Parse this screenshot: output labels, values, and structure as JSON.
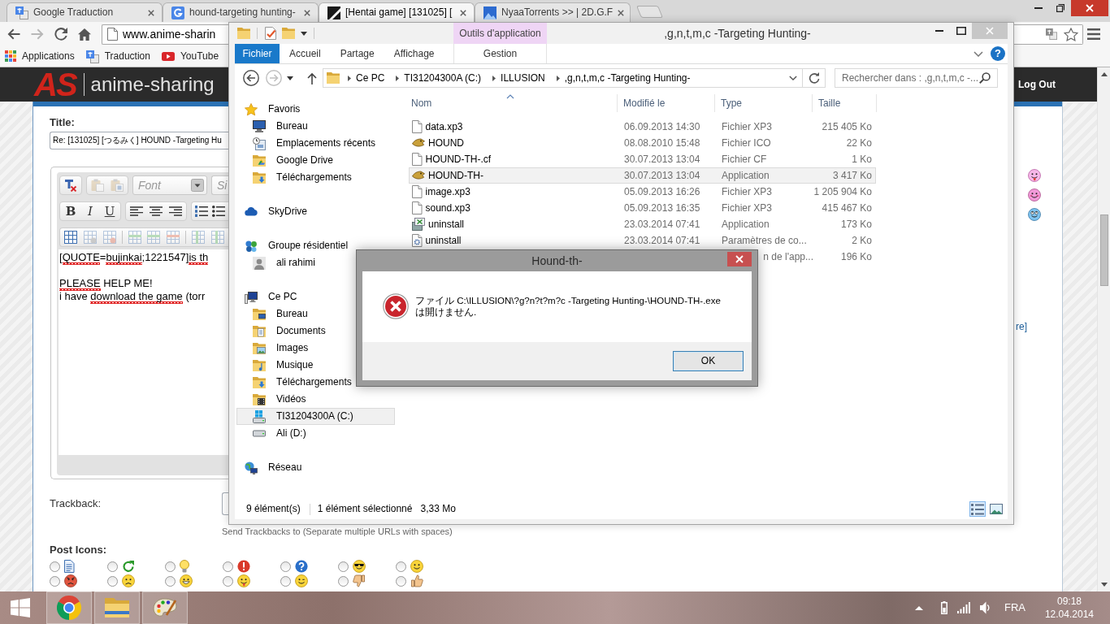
{
  "browser": {
    "tabs": [
      {
        "title": "Google Traduction",
        "kind": "translate",
        "selected": false
      },
      {
        "title": "hound-targeting hunting-",
        "kind": "search",
        "selected": false
      },
      {
        "title": "[Hentai game] [131025] [",
        "kind": "site",
        "selected": true
      },
      {
        "title": "NyaaTorrents >> | 2D.G.F",
        "kind": "torrents",
        "selected": false
      }
    ],
    "address": "www.anime-sharin",
    "bookmarks": [
      {
        "label": "Applications",
        "kind": "apps"
      },
      {
        "label": "Traduction",
        "kind": "translate"
      },
      {
        "label": "YouTube",
        "kind": "video"
      }
    ],
    "page": {
      "logo_mark": "AS",
      "site_name": "anime-sharing",
      "logout": "Log Out",
      "title_label": "Title:",
      "title_value": "Re: [131025] [つるみく] HOUND -Targeting Hu",
      "editor": {
        "toolbar": [
          {
            "kind": "boxed",
            "groups": [
              [
                {
                  "kind": "clear-format",
                  "disabled": false
                }
              ],
              [
                {
                  "kind": "paste",
                  "disabled": true
                },
                {
                  "kind": "paste-word",
                  "disabled": true
                }
              ],
              [
                {
                  "kind": "select",
                  "placeholder": "Font"
                }
              ],
              [
                {
                  "kind": "select",
                  "placeholder": "Si"
                }
              ]
            ]
          },
          {
            "kind": "boxed",
            "groups": [
              [
                {
                  "kind": "bold",
                  "label": "B"
                },
                {
                  "kind": "italic",
                  "label": "I"
                },
                {
                  "kind": "underline",
                  "label": "U"
                }
              ],
              [
                {
                  "kind": "align-left",
                  "disabled": false
                },
                {
                  "kind": "align-center",
                  "disabled": false
                },
                {
                  "kind": "align-right",
                  "disabled": false
                }
              ],
              [
                {
                  "kind": "numbered-list",
                  "disabled": false
                },
                {
                  "kind": "bullet-list",
                  "disabled": false
                }
              ]
            ]
          },
          {
            "kind": "strip",
            "groups": [
              [
                {
                  "kind": "table",
                  "disabled": false
                },
                {
                  "kind": "table-settings",
                  "disabled": true
                },
                {
                  "kind": "table-delete",
                  "disabled": true
                }
              ],
              [
                {
                  "kind": "row-insert",
                  "disabled": true
                },
                {
                  "kind": "row-insert",
                  "disabled": true
                },
                {
                  "kind": "row-delete",
                  "disabled": true
                }
              ],
              [
                {
                  "kind": "column-insert",
                  "disabled": true
                },
                {
                  "kind": "column-insert",
                  "disabled": true
                }
              ]
            ]
          }
        ],
        "paragraphs": [
          {
            "lines": [
              [
                {
                  "text": "[",
                  "misspelled": false
                },
                {
                  "text": "QUOTE",
                  "misspelled": true
                },
                {
                  "text": "=",
                  "misspelled": false
                },
                {
                  "text": "bujinkai",
                  "misspelled": true
                },
                {
                  "text": ";1221547]",
                  "misspelled": false
                },
                {
                  "text": "is th",
                  "misspelled": true
                }
              ]
            ]
          },
          {
            "lines": [
              [
                {
                  "text": "PLEASE",
                  "misspelled": true
                },
                {
                  "text": " HELP ME!",
                  "misspelled": false
                }
              ],
              [
                {
                  "text": "i have ",
                  "misspelled": false
                },
                {
                  "text": "download the game",
                  "misspelled": true
                },
                {
                  "text": " (torr",
                  "misspelled": false
                }
              ]
            ]
          }
        ]
      },
      "trackback_label": "Trackback:",
      "trackback_hint": "Send Trackbacks to (Separate multiple URLs with spaces)",
      "post_icons_label": "Post Icons:",
      "post_icons": [
        {
          "kind": "document",
          "selected": false
        },
        {
          "kind": "arrows",
          "selected": false
        },
        {
          "kind": "bulb",
          "selected": false
        },
        {
          "kind": "exclamation",
          "selected": false
        },
        {
          "kind": "question",
          "selected": false
        },
        {
          "kind": "cool",
          "selected": false
        },
        {
          "kind": "smile",
          "selected": false
        },
        {
          "kind": "angry",
          "selected": false
        },
        {
          "kind": "frown",
          "selected": false
        },
        {
          "kind": "grin",
          "selected": false
        },
        {
          "kind": "tongue",
          "selected": false
        },
        {
          "kind": "wink",
          "selected": false
        },
        {
          "kind": "thumbs-down",
          "selected": false
        },
        {
          "kind": "thumbs-up",
          "selected": false
        }
      ],
      "smilies": [
        {
          "kind": "tongue"
        },
        {
          "kind": "blush"
        },
        {
          "kind": "rolleyes"
        }
      ],
      "more_link": "re]"
    }
  },
  "explorer": {
    "active": false,
    "contextual_group": "Outils d'application",
    "title": ",g,n,t,m,c -Targeting Hunting-",
    "ribbon_tabs": [
      {
        "label": "Fichier",
        "kind": "file",
        "selected": false
      },
      {
        "label": "Accueil",
        "kind": "tab",
        "selected": false
      },
      {
        "label": "Partage",
        "kind": "tab",
        "selected": false
      },
      {
        "label": "Affichage",
        "kind": "tab",
        "selected": false
      },
      {
        "label": "Gestion",
        "kind": "contextual",
        "selected": false
      }
    ],
    "help": "?",
    "nav_buttons": [
      {
        "kind": "back",
        "disabled": false
      },
      {
        "kind": "forward",
        "disabled": true
      }
    ],
    "breadcrumb": [
      "Ce PC",
      "TI31204300A (C:)",
      "ILLUSION",
      ",g,n,t,m,c -Targeting Hunting-"
    ],
    "search_placeholder": "Rechercher dans : ,g,n,t,m,c -...",
    "nav": [
      {
        "label": "Favoris",
        "kind": "favorites",
        "selected": false,
        "children": [
          {
            "label": "Bureau",
            "kind": "desktop",
            "selected": false
          },
          {
            "label": "Emplacements récents",
            "kind": "recent",
            "selected": false
          },
          {
            "label": "Google Drive",
            "kind": "drive-folder",
            "selected": false
          },
          {
            "label": "Téléchargements",
            "kind": "downloads",
            "selected": false
          }
        ]
      },
      {
        "label": "SkyDrive",
        "kind": "cloud",
        "selected": false
      },
      {
        "label": "Groupe résidentiel",
        "kind": "homegroup",
        "selected": false,
        "children": [
          {
            "label": "ali rahimi",
            "kind": "user",
            "selected": false
          }
        ]
      },
      {
        "label": "Ce PC",
        "kind": "computer",
        "selected": false,
        "children": [
          {
            "label": "Bureau",
            "kind": "desktop-folder",
            "selected": false
          },
          {
            "label": "Documents",
            "kind": "documents",
            "selected": false
          },
          {
            "label": "Images",
            "kind": "pictures",
            "selected": false
          },
          {
            "label": "Musique",
            "kind": "music",
            "selected": false
          },
          {
            "label": "Téléchargements",
            "kind": "downloads",
            "selected": false
          },
          {
            "label": "Vidéos",
            "kind": "videos",
            "selected": false
          },
          {
            "label": "TI31204300A (C:)",
            "kind": "system-drive",
            "selected": true
          },
          {
            "label": "Ali (D:)",
            "kind": "drive",
            "selected": false
          }
        ]
      },
      {
        "label": "Réseau",
        "kind": "network",
        "selected": false
      }
    ],
    "columns": [
      {
        "label": "Nom",
        "sorted": true
      },
      {
        "label": "Modifié le",
        "sorted": false
      },
      {
        "label": "Type",
        "sorted": false
      },
      {
        "label": "Taille",
        "sorted": false
      }
    ],
    "rows": [
      {
        "kind": "document",
        "name": "data.xp3",
        "modified": "06.09.2013 14:30",
        "type": "Fichier XP3",
        "size": "215 405 Ko",
        "selected": false
      },
      {
        "kind": "game",
        "name": "HOUND",
        "modified": "08.08.2010 15:48",
        "type": "Fichier ICO",
        "size": "22 Ko",
        "selected": false
      },
      {
        "kind": "document",
        "name": "HOUND-TH-.cf",
        "modified": "30.07.2013 13:04",
        "type": "Fichier CF",
        "size": "1 Ko",
        "selected": false
      },
      {
        "kind": "game",
        "name": "HOUND-TH-",
        "modified": "30.07.2013 13:04",
        "type": "Application",
        "size": "3 417 Ko",
        "selected": true
      },
      {
        "kind": "document",
        "name": "image.xp3",
        "modified": "05.09.2013 16:26",
        "type": "Fichier XP3",
        "size": "1 205 904 Ko",
        "selected": false
      },
      {
        "kind": "document",
        "name": "sound.xp3",
        "modified": "05.09.2013 16:35",
        "type": "Fichier XP3",
        "size": "415 467 Ko",
        "selected": false
      },
      {
        "kind": "installer",
        "name": "uninstall",
        "modified": "23.03.2014 07:41",
        "type": "Application",
        "size": "173 Ko",
        "selected": false
      },
      {
        "kind": "config",
        "name": "uninstall",
        "modified": "23.03.2014 07:41",
        "type": "Paramètres de co...",
        "size": "2 Ko",
        "selected": false
      },
      {
        "type": "n de l'app...",
        "size": "196 Ko",
        "selected": false
      }
    ],
    "status": {
      "count": "9 élément(s)",
      "selection": "1 élément sélectionné",
      "selection_size": "3,33 Mo"
    },
    "views": [
      {
        "kind": "details",
        "selected": true
      },
      {
        "kind": "large-icons",
        "selected": false
      }
    ]
  },
  "dialog": {
    "title": "Hound-th-",
    "kind": "error",
    "message_lines": [
      "ファイル C:\\ILLUSION\\?g?n?t?m?c -Targeting Hunting-\\HOUND-TH-.exe",
      "は開けません."
    ],
    "buttons": [
      {
        "label": "OK",
        "default": true
      }
    ]
  },
  "taskbar": {
    "apps": [
      {
        "kind": "browser",
        "running": true
      },
      {
        "kind": "files",
        "running": true
      },
      {
        "kind": "paint",
        "running": true
      }
    ],
    "language": "FRA",
    "time": "09:18",
    "date": "12.04.2014"
  }
}
